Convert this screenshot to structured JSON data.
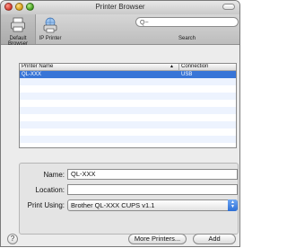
{
  "window": {
    "title": "Printer Browser"
  },
  "toolbar": {
    "default_browser_label": "Default Browser",
    "ip_printer_label": "IP Printer",
    "search_placeholder": "Q~",
    "search_label": "Search"
  },
  "list": {
    "columns": {
      "name": "Printer Name",
      "connection": "Connection",
      "sort_indicator": "▲"
    },
    "rows": [
      {
        "name": "QL-XXX",
        "connection": "USB",
        "selected": true
      }
    ]
  },
  "details": {
    "name_label": "Name:",
    "name_value": "QL-XXX",
    "location_label": "Location:",
    "location_value": "",
    "print_using_label": "Print Using:",
    "print_using_value": "Brother QL-XXX    CUPS v1.1"
  },
  "buttons": {
    "help": "?",
    "more_printers": "More Printers...",
    "add": "Add"
  },
  "colors": {
    "selection": "#3875d7",
    "select_accent": "#2d6fd6"
  }
}
